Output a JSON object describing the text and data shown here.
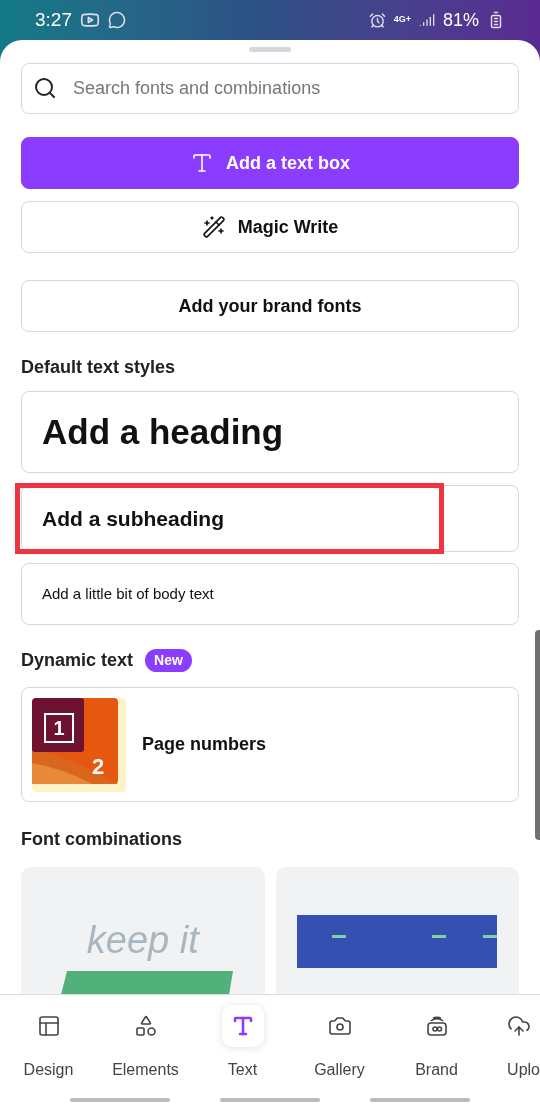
{
  "status_bar": {
    "time": "3:27",
    "network": "4G+",
    "battery": "81%"
  },
  "search": {
    "placeholder": "Search fonts and combinations"
  },
  "actions": [
    {
      "kind": "primary",
      "label": "Add a text box"
    },
    {
      "kind": "magic",
      "label": "Magic Write"
    },
    {
      "kind": "plain",
      "label": "Add your brand fonts"
    }
  ],
  "default_styles": {
    "title": "Default text styles",
    "items": [
      {
        "kind": "heading",
        "label": "Add a heading",
        "highlighted": false
      },
      {
        "kind": "subheading",
        "label": "Add a subheading",
        "highlighted": true
      },
      {
        "kind": "body",
        "label": "Add a little bit of body text",
        "highlighted": false
      }
    ]
  },
  "dynamic": {
    "title": "Dynamic text",
    "badge": "New",
    "items": [
      {
        "label": "Page numbers",
        "thumb_numbers": [
          "1",
          "2"
        ]
      }
    ]
  },
  "font_combinations": {
    "title": "Font combinations",
    "cards": [
      {
        "kind": "simple",
        "lines": [
          "keep it"
        ]
      },
      {
        "kind": "free"
      }
    ]
  },
  "nav": [
    {
      "kind": "design",
      "label": "Design",
      "selected": false
    },
    {
      "kind": "elements",
      "label": "Elements",
      "selected": false
    },
    {
      "kind": "text",
      "label": "Text",
      "selected": true
    },
    {
      "kind": "gallery",
      "label": "Gallery",
      "selected": false
    },
    {
      "kind": "brand",
      "label": "Brand",
      "selected": false
    },
    {
      "kind": "uploads",
      "label": "Uplo",
      "selected": false
    }
  ]
}
